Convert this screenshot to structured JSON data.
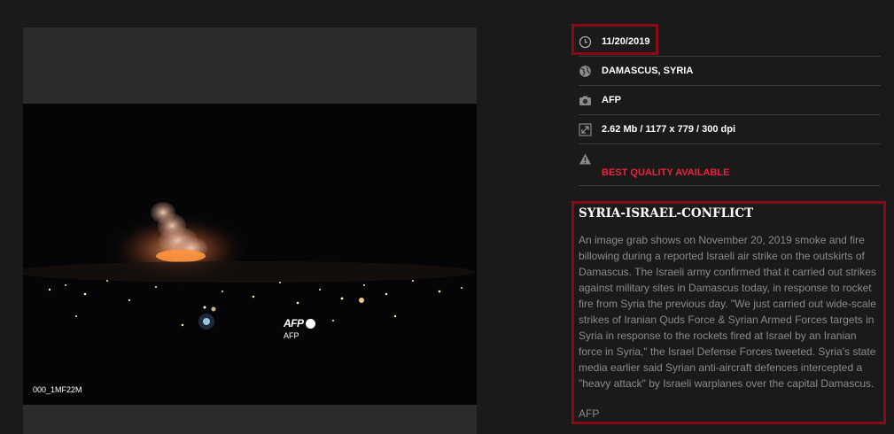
{
  "image": {
    "afp_logo": "AFP",
    "afp_caption": "AFP",
    "image_id": "000_1MF22M"
  },
  "meta": {
    "date": "11/20/2019",
    "location": "DAMASCUS, SYRIA",
    "credit": "AFP",
    "file_info": "2.62 Mb / 1177 x 779 / 300 dpi",
    "quality_warning": "BEST QUALITY AVAILABLE"
  },
  "caption": {
    "title": "SYRIA-ISRAEL-CONFLICT",
    "body": "An image grab shows on November 20, 2019 smoke and fire billowing during a reported Israeli air strike on the outskirts of Damascus. The Israeli army confirmed that it carried out strikes against military sites in Damascus today, in response to rocket fire from Syria the previous day. \"We just carried out wide-scale strikes of Iranian Quds Force & Syrian Armed Forces targets in Syria in response to the rockets fired at Israel by an Iranian force in Syria,\" the Israel Defense Forces tweeted. Syria's state media earlier said Syrian anti-aircraft defences intercepted a \"heavy attack\" by Israeli warplanes over the capital Damascus.",
    "credit": "AFP"
  },
  "colors": {
    "highlight_border": "#8a0a1a",
    "warning_text": "#e8233f"
  },
  "icons": [
    "clock-icon",
    "globe-icon",
    "camera-icon",
    "resize-icon",
    "warning-icon"
  ]
}
